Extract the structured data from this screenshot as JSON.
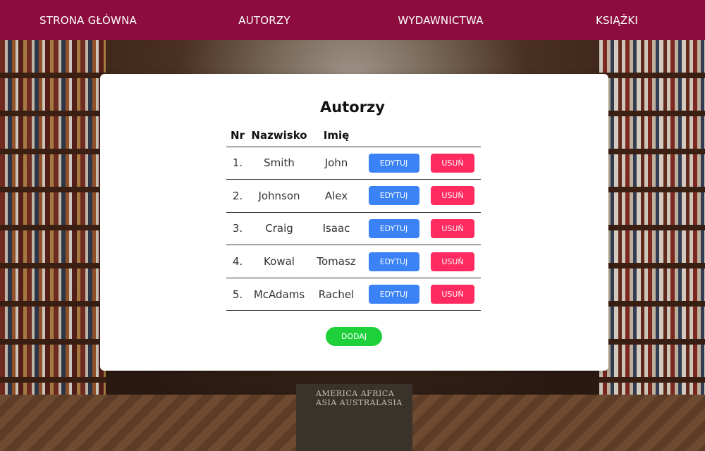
{
  "nav": {
    "items": [
      {
        "label": "STRONA GŁÓWNA"
      },
      {
        "label": "AUTORZY"
      },
      {
        "label": "WYDAWNICTWA"
      },
      {
        "label": "KSIĄŻKI"
      }
    ]
  },
  "background": {
    "sign_line1": "AMERICA   AFRICA",
    "sign_line2": "ASIA   AUSTRALASIA"
  },
  "main": {
    "title": "Autorzy",
    "headers": {
      "nr": "Nr",
      "surname": "Nazwisko",
      "name": "Imię"
    },
    "rows": [
      {
        "nr": "1.",
        "surname": "Smith",
        "name": "John",
        "edit": "EDYTUJ",
        "delete": "USUŃ"
      },
      {
        "nr": "2.",
        "surname": "Johnson",
        "name": "Alex",
        "edit": "EDYTUJ",
        "delete": "USUŃ"
      },
      {
        "nr": "3.",
        "surname": "Craig",
        "name": "Isaac",
        "edit": "EDYTUJ",
        "delete": "USUŃ"
      },
      {
        "nr": "4.",
        "surname": "Kowal",
        "name": "Tomasz",
        "edit": "EDYTUJ",
        "delete": "USUŃ"
      },
      {
        "nr": "5.",
        "surname": "McAdams",
        "name": "Rachel",
        "edit": "EDYTUJ",
        "delete": "USUŃ"
      }
    ],
    "add_label": "DODAJ"
  },
  "colors": {
    "nav_bg": "#8c0d3d",
    "edit": "#3b82f6",
    "delete": "#ff2a5f",
    "add": "#1ed13a"
  }
}
